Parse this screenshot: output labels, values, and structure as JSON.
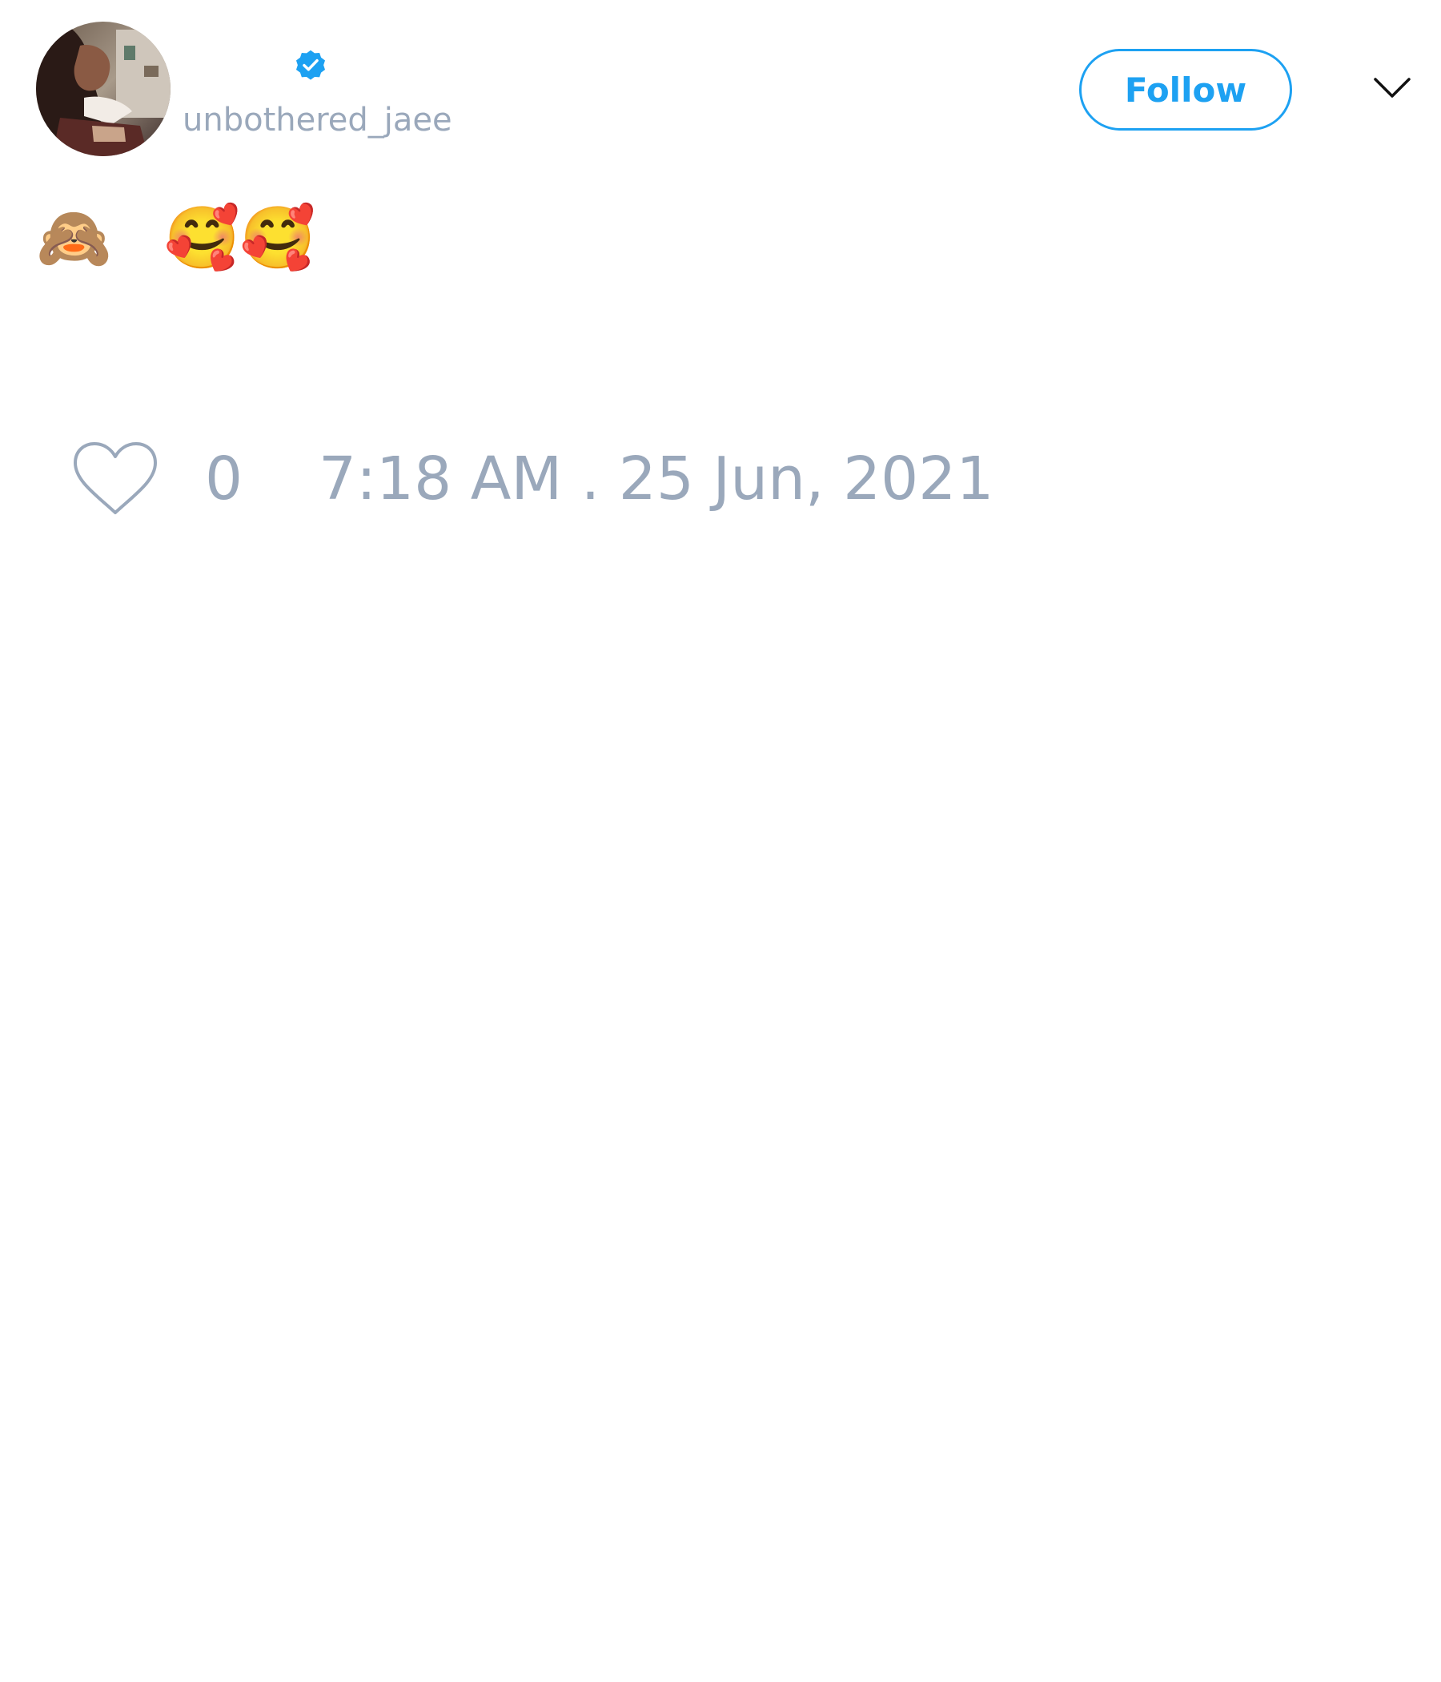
{
  "tweet": {
    "author": {
      "avatar_icon": "profile-photo",
      "verified_icon": "verified-badge-icon",
      "handle": "unbothered_jaee"
    },
    "follow_button_label": "Follow",
    "menu_icon": "chevron-down-icon",
    "text_segments": [
      "🙈",
      "🥰🥰"
    ],
    "likes": {
      "icon": "heart-icon",
      "count": "0"
    },
    "timestamp": "7:18 AM . 25 Jun, 2021"
  },
  "colors": {
    "accent": "#1da1f2",
    "muted_text": "#9aa8bb",
    "background": "#ffffff"
  }
}
